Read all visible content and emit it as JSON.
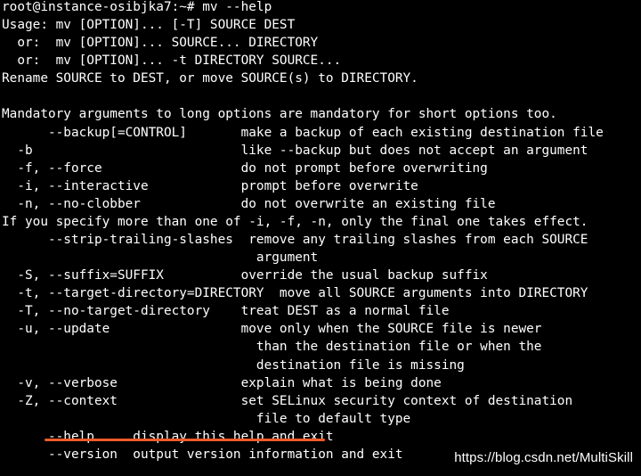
{
  "terminal": {
    "lines": [
      "root@instance-osibjka7:~# mv --help",
      "Usage: mv [OPTION]... [-T] SOURCE DEST",
      "  or:  mv [OPTION]... SOURCE... DIRECTORY",
      "  or:  mv [OPTION]... -t DIRECTORY SOURCE...",
      "Rename SOURCE to DEST, or move SOURCE(s) to DIRECTORY.",
      "",
      "Mandatory arguments to long options are mandatory for short options too.",
      "      --backup[=CONTROL]       make a backup of each existing destination file",
      "  -b                           like --backup but does not accept an argument",
      "  -f, --force                  do not prompt before overwriting",
      "  -i, --interactive            prompt before overwrite",
      "  -n, --no-clobber             do not overwrite an existing file",
      "If you specify more than one of -i, -f, -n, only the final one takes effect.",
      "      --strip-trailing-slashes  remove any trailing slashes from each SOURCE",
      "                                 argument",
      "  -S, --suffix=SUFFIX          override the usual backup suffix",
      "  -t, --target-directory=DIRECTORY  move all SOURCE arguments into DIRECTORY",
      "  -T, --no-target-directory    treat DEST as a normal file",
      "  -u, --update                 move only when the SOURCE file is newer",
      "                                 than the destination file or when the",
      "                                 destination file is missing",
      "  -v, --verbose                explain what is being done",
      "  -Z, --context                set SELinux security context of destination",
      "                                 file to default type",
      "      --help     display this help and exit",
      "      --version  output version information and exit"
    ]
  },
  "watermark": "https://blog.csdn.net/MultiSkill",
  "colors": {
    "background": "#000000",
    "text": "#ffffff",
    "underline": "#f05a28"
  }
}
